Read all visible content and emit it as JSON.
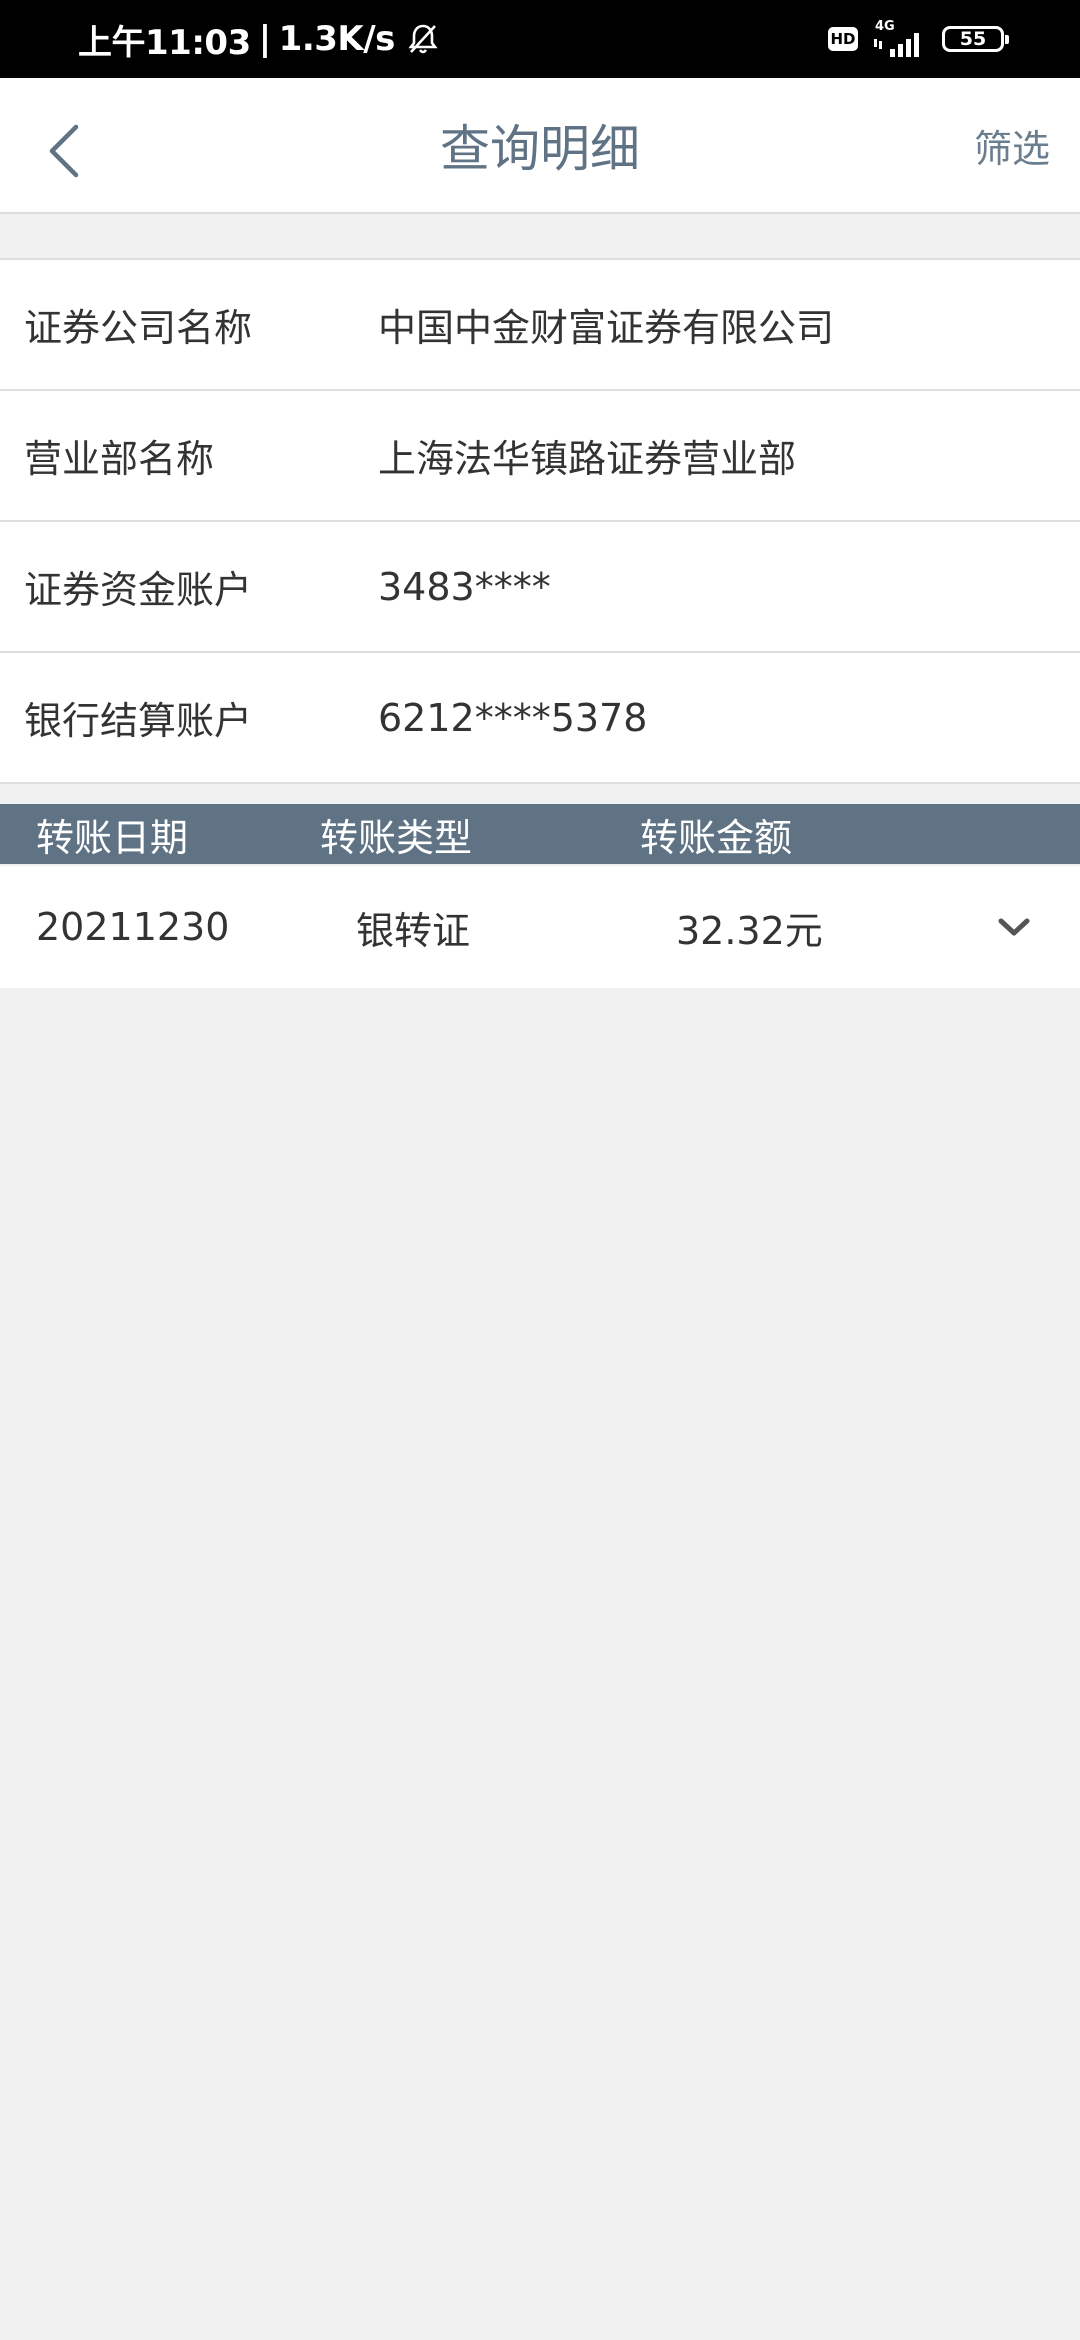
{
  "status_bar": {
    "time": "上午11:03",
    "network_speed": "1.3K/s",
    "hd_label": "HD",
    "network_type": "4G",
    "battery": "55"
  },
  "nav": {
    "title": "查询明细",
    "filter_label": "筛选"
  },
  "info": [
    {
      "label": "证券公司名称",
      "value": "中国中金财富证券有限公司"
    },
    {
      "label": "营业部名称",
      "value": "上海法华镇路证券营业部"
    },
    {
      "label": "证券资金账户",
      "value": "3483****"
    },
    {
      "label": "银行结算账户",
      "value": "6212****5378"
    }
  ],
  "table": {
    "headers": {
      "date": "转账日期",
      "type": "转账类型",
      "amount": "转账金额"
    },
    "rows": [
      {
        "date": "20211230",
        "type": "银转证",
        "amount": "32.32元"
      }
    ]
  }
}
